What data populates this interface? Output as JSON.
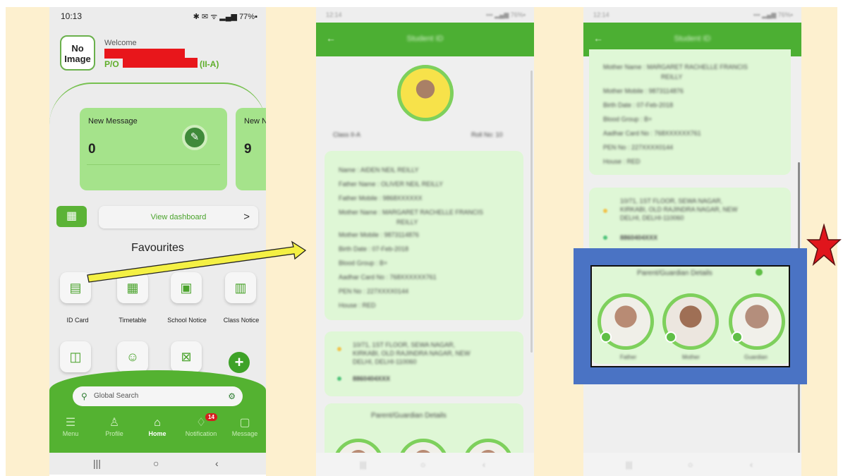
{
  "phone1": {
    "status": {
      "time": "10:13",
      "icons": "✱ ✉ ᯤ ▂▄▆ 77%▪",
      "battery": "77%"
    },
    "profile": {
      "avatar_text": "No Image",
      "welcome": "Welcome",
      "po_label": "P/O",
      "class_label": "(II-A)"
    },
    "cards": [
      {
        "label": "New Message",
        "count": "0"
      },
      {
        "label": "New N",
        "count": "9"
      }
    ],
    "dashboard": {
      "icon": "grid-icon",
      "label": "View dashboard",
      "chevron": ">"
    },
    "favourites_title": "Favourites",
    "favourites": [
      {
        "label": "ID Card",
        "icon": "id-card-icon"
      },
      {
        "label": "Timetable",
        "icon": "timetable-icon"
      },
      {
        "label": "School Notice",
        "icon": "school-notice-icon"
      },
      {
        "label": "Class Notice",
        "icon": "class-notice-icon"
      }
    ],
    "favourites_row2": [
      {
        "icon": "document-icon"
      },
      {
        "icon": "user-switch-icon"
      },
      {
        "icon": "calendar-x-icon"
      }
    ],
    "search_placeholder": "Global Search",
    "nav": [
      {
        "label": "Menu",
        "icon": "menu-icon"
      },
      {
        "label": "Profile",
        "icon": "person-icon"
      },
      {
        "label": "Home",
        "icon": "home-icon",
        "active": true
      },
      {
        "label": "Notification",
        "icon": "bell-icon",
        "badge": "14"
      },
      {
        "label": "Message",
        "icon": "message-icon"
      }
    ]
  },
  "phone2": {
    "status": {
      "time": "12:14",
      "icons": "▪▪▪ ▂▄▆ 76%▪"
    },
    "header_title": "Student ID",
    "class_line": "Class II-A",
    "roll_line": "Roll No: 10",
    "details": [
      "Name : AIDEN NEIL REILLY",
      "Father Name : OLIVER NEIL REILLY",
      "Father Mobile : 9868XXXXXX",
      "Mother Name : MARGARET RACHELLE FRANCIS",
      "REILLY",
      "Mother Mobile : 9873114876",
      "Birth Date : 07-Feb-2018",
      "Blood Group : B+",
      "Aadhar Card No : 768XXXXXX761",
      "PEN No : 227XXXX0144",
      "House : RED"
    ],
    "address": [
      "10/71, 1ST FLOOR, SEWA NAGAR,",
      "KIRKABI, OLD RAJINDRA NAGAR, NEW",
      "DELHI, DELHI-110060"
    ],
    "phone": "8860404XXX",
    "guardian_title": "Parent/Guardian Details"
  },
  "phone3": {
    "status": {
      "time": "12:14",
      "icons": "▪▪▪ ▂▄▆ 76%▪"
    },
    "header_title": "Student ID",
    "details": [
      "Mother Name : MARGARET RACHELLE FRANCIS",
      "REILLY",
      "Mother Mobile : 9873114876",
      "Birth Date : 07-Feb-2018",
      "Blood Group : B+",
      "Aadhar Card No : 768XXXXXX761",
      "PEN No : 227XXXX0144",
      "House : RED"
    ],
    "address": [
      "10/71, 1ST FLOOR, SEWA NAGAR,",
      "KIRKABI, OLD RAJINDRA NAGAR, NEW",
      "DELHI, DELHI-110060"
    ],
    "phone": "8860404XXX",
    "guardian_title": "Parent/Guardian Details",
    "guardians": [
      "Father",
      "Mother",
      "Guardian"
    ]
  },
  "annotation": {
    "arrow_color": "#f4f044",
    "highlight_color": "#4a73c4",
    "star_color": "#e0151c"
  }
}
